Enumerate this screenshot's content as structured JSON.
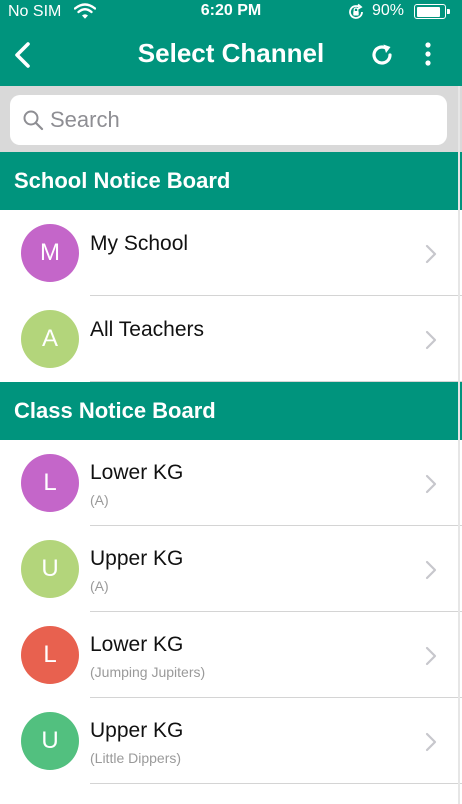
{
  "status_bar": {
    "carrier": "No SIM",
    "time": "6:20 PM",
    "battery_percent": "90%",
    "battery_level": 0.9
  },
  "nav": {
    "title": "Select Channel"
  },
  "search": {
    "placeholder": "Search",
    "value": ""
  },
  "sections": [
    {
      "title": "School Notice Board",
      "items": [
        {
          "initial": "M",
          "name": "My School",
          "sub": "",
          "color": "#c466c9"
        },
        {
          "initial": "A",
          "name": "All Teachers",
          "sub": "",
          "color": "#b3d57b"
        }
      ]
    },
    {
      "title": "Class Notice Board",
      "items": [
        {
          "initial": "L",
          "name": "Lower KG",
          "sub": "(A)",
          "color": "#c466c9"
        },
        {
          "initial": "U",
          "name": "Upper KG",
          "sub": "(A)",
          "color": "#b3d57b"
        },
        {
          "initial": "L",
          "name": "Lower KG",
          "sub": "(Jumping Jupiters)",
          "color": "#e8614f"
        },
        {
          "initial": "U",
          "name": "Upper KG",
          "sub": "(Little Dippers)",
          "color": "#52c07f"
        }
      ]
    }
  ],
  "colors": {
    "primary": "#00947d",
    "search_bg": "#d9d9d9",
    "divider": "#d4d4d4"
  },
  "icons": {
    "back": "chevron-left-icon",
    "refresh": "refresh-icon",
    "more": "more-vertical-icon",
    "search": "search-icon",
    "row": "chevron-right-icon"
  }
}
